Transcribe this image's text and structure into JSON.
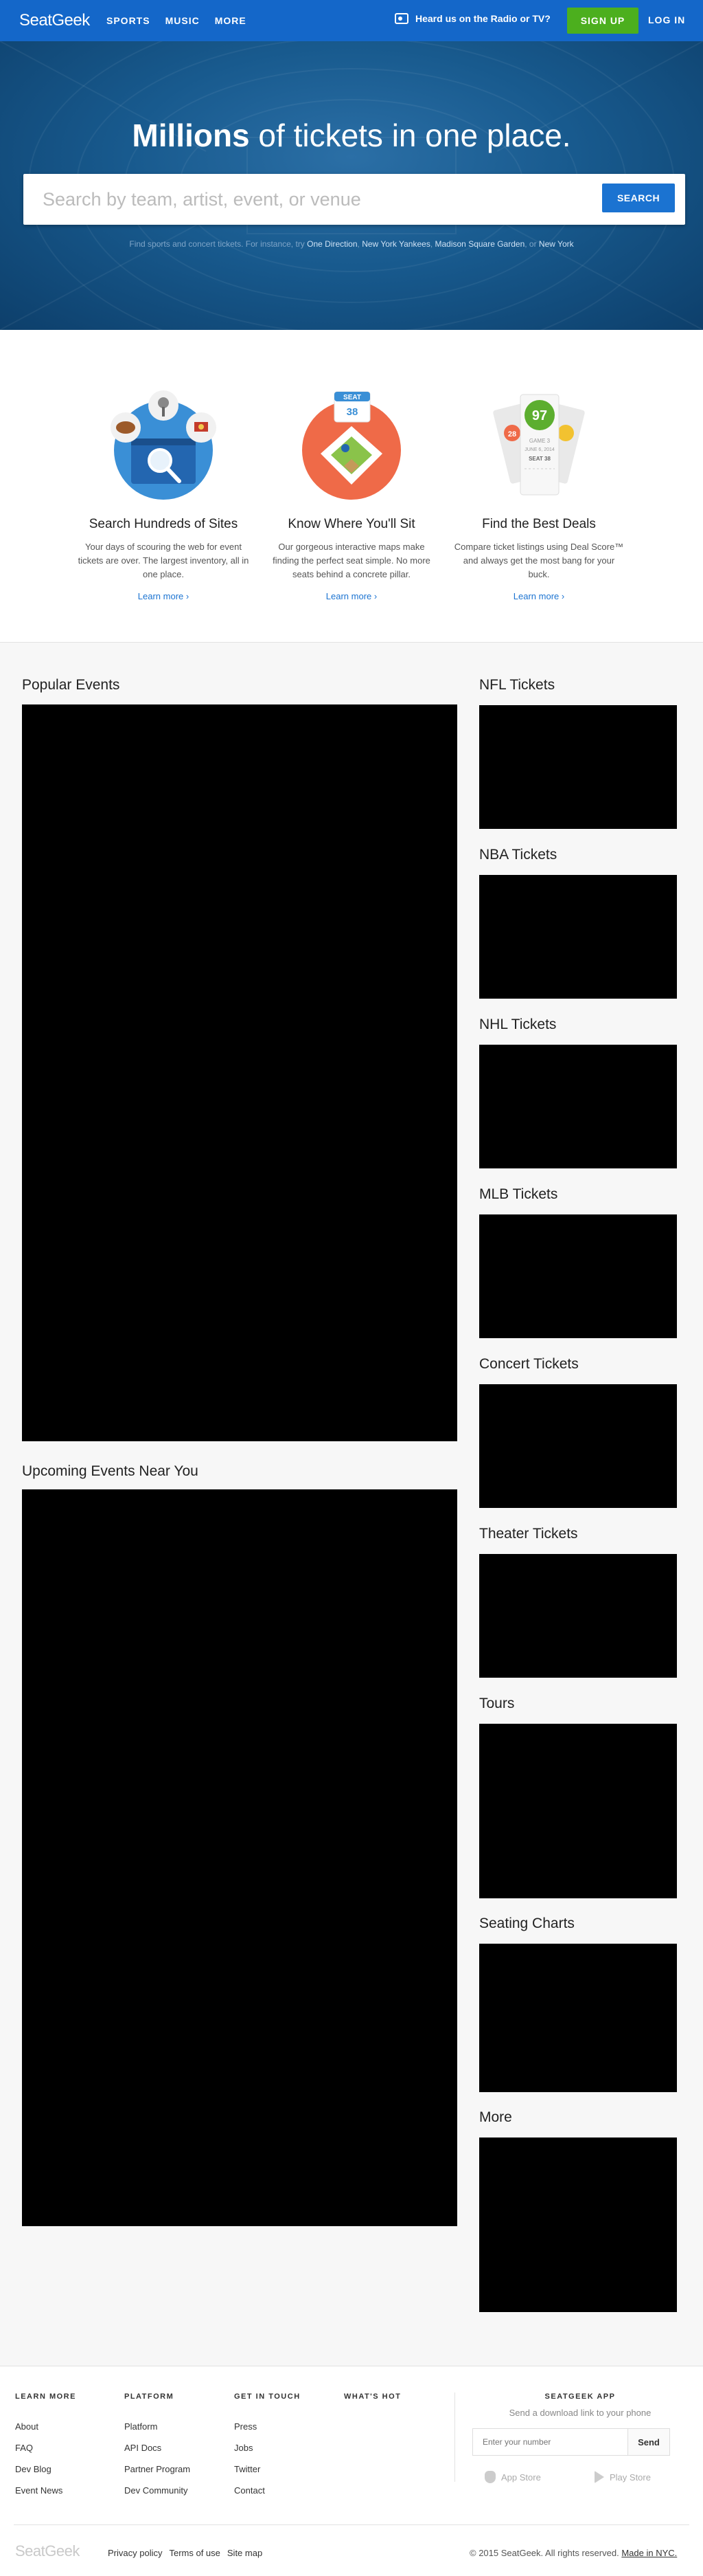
{
  "nav": {
    "logo": "SeatGeek",
    "links": [
      "SPORTS",
      "MUSIC",
      "MORE"
    ],
    "radio": "Heard us on the Radio or TV?",
    "signup": "SIGN UP",
    "login": "LOG IN"
  },
  "hero": {
    "title_bold": "Millions",
    "title_rest": " of tickets in one place.",
    "search_placeholder": "Search by team, artist, event, or venue",
    "search_button": "SEARCH",
    "hint_prefix": "Find sports and concert tickets. For instance, try ",
    "hint_links": [
      "One Direction",
      "New York Yankees",
      "Madison Square Garden"
    ],
    "hint_or": ", or ",
    "hint_last": "New York"
  },
  "features": [
    {
      "title": "Search Hundreds of Sites",
      "text": "Your days of scouring the web for event tickets are over. The largest inventory, all in one place.",
      "link": "Learn more ›"
    },
    {
      "title": "Know Where You'll Sit",
      "text": "Our gorgeous interactive maps make finding the perfect seat simple. No more seats behind a concrete pillar.",
      "link": "Learn more ›"
    },
    {
      "title": "Find the Best Deals",
      "text": "Compare ticket listings using Deal Score™ and always get the most bang for your buck.",
      "link": "Learn more ›"
    }
  ],
  "feature_art": {
    "seat_label": "SEAT",
    "seat_num": "38",
    "score": "97",
    "score_side_left": "28",
    "ticket_line1": "GAME 3",
    "ticket_line2": "JUNE 6, 2014",
    "ticket_line3": "SEAT 38"
  },
  "main": {
    "popular": "Popular Events",
    "upcoming": "Upcoming Events Near You",
    "sidebar": [
      "NFL Tickets",
      "NBA Tickets",
      "NHL Tickets",
      "MLB Tickets",
      "Concert Tickets",
      "Theater Tickets",
      "Tours",
      "Seating Charts",
      "More"
    ]
  },
  "footer": {
    "columns": [
      {
        "title": "LEARN MORE",
        "links": [
          "About",
          "FAQ",
          "Dev Blog",
          "Event News"
        ]
      },
      {
        "title": "PLATFORM",
        "links": [
          "Platform",
          "API Docs",
          "Partner Program",
          "Dev Community"
        ]
      },
      {
        "title": "GET IN TOUCH",
        "links": [
          "Press",
          "Jobs",
          "Twitter",
          "Contact"
        ]
      },
      {
        "title": "WHAT'S HOT",
        "links": []
      }
    ],
    "app_title": "SEATGEEK APP",
    "app_sub": "Send a download link to your phone",
    "phone_placeholder": "Enter your number",
    "send": "Send",
    "app_store": "App Store",
    "play_store": "Play Store",
    "logo": "SeatGeek",
    "bottom_links": [
      "Privacy policy",
      "Terms of use",
      "Site map"
    ],
    "copyright": "© 2015 SeatGeek. All rights reserved.",
    "made_in": "Made in NYC."
  },
  "colors": {
    "brand_blue": "#1467c9",
    "signup_green": "#4caf1e",
    "link_blue": "#1b73d1"
  }
}
